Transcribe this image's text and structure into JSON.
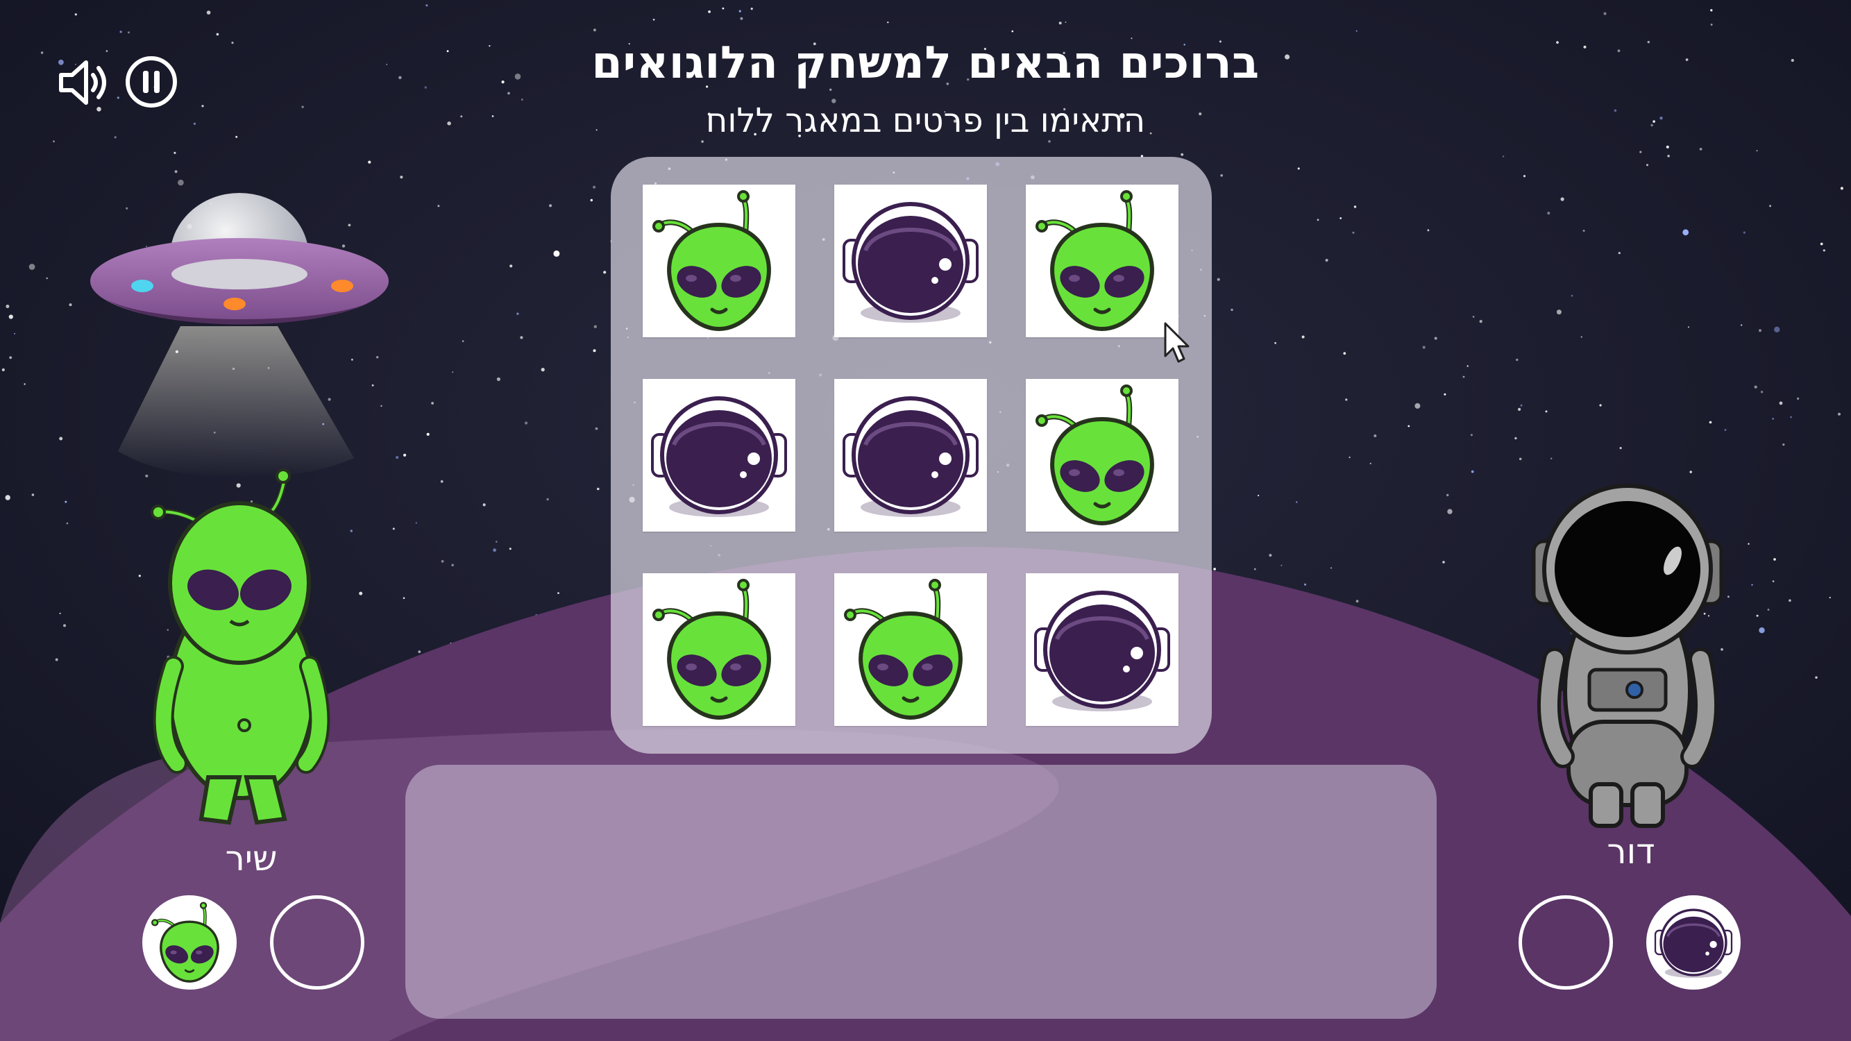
{
  "header": {
    "title": "ברוכים הבאים למשחק הלוגואים",
    "subtitle": "התאימו בין פרטים במאגר ללוח"
  },
  "controls": [
    {
      "name": "sound-icon"
    },
    {
      "name": "pause-icon"
    }
  ],
  "board": {
    "cards": [
      "alien",
      "astronaut-helmet",
      "alien",
      "astronaut-helmet",
      "astronaut-helmet",
      "alien",
      "alien",
      "alien",
      "astronaut-helmet"
    ]
  },
  "players": {
    "left": {
      "name": "שיר",
      "slots": [
        "alien",
        "empty"
      ]
    },
    "right": {
      "name": "דור",
      "slots": [
        "empty",
        "astronaut-helmet"
      ]
    }
  },
  "colors": {
    "sky": "#161725",
    "planet": "#5a3566",
    "alien_green": "#68e23a",
    "helmet_purple": "#3a1f4f"
  }
}
